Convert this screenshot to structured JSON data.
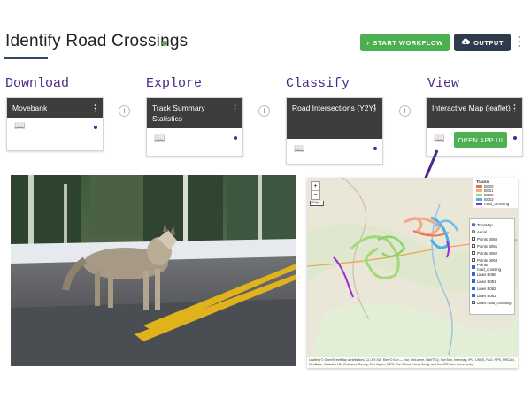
{
  "header": {
    "title": "Identify Road Crossings",
    "start_workflow": "START WORKFLOW",
    "output": "OUTPUT",
    "status_color": "#4caf50"
  },
  "sections": [
    {
      "label": "Download",
      "card_title": "Movebank"
    },
    {
      "label": "Explore",
      "card_title": "Track Summary Statistics"
    },
    {
      "label": "Classify",
      "card_title": "Road Intersections (Y2Y)"
    },
    {
      "label": "View",
      "card_title": "Interactive Map (leaflet)",
      "action": "OPEN APP UI"
    }
  ],
  "map": {
    "legend_title": "Tracks",
    "legend": [
      {
        "label": "B060",
        "color": "#e8734a"
      },
      {
        "label": "B061",
        "color": "#f2a98a"
      },
      {
        "label": "B062",
        "color": "#a3d97a"
      },
      {
        "label": "B063",
        "color": "#4ab0e8"
      },
      {
        "label": "road_crossing",
        "color": "#9c2bd6"
      }
    ],
    "layers": [
      {
        "label": "TopoMap",
        "type": "radio",
        "checked": true
      },
      {
        "label": "Aerial",
        "type": "radio",
        "checked": false
      },
      {
        "label": "Points B060",
        "type": "check",
        "checked": false
      },
      {
        "label": "Points B061",
        "type": "check",
        "checked": false
      },
      {
        "label": "Points B062",
        "type": "check",
        "checked": false
      },
      {
        "label": "Points B063",
        "type": "check",
        "checked": false
      },
      {
        "label": "Points road_crossing",
        "type": "check",
        "checked": true
      },
      {
        "label": "Lines B060",
        "type": "check",
        "checked": true
      },
      {
        "label": "Lines B061",
        "type": "check",
        "checked": true
      },
      {
        "label": "Lines B062",
        "type": "check",
        "checked": true
      },
      {
        "label": "Lines B063",
        "type": "check",
        "checked": true
      },
      {
        "label": "Lines road_crossing",
        "type": "check",
        "checked": false
      }
    ],
    "zoom_in": "+",
    "zoom_out": "−",
    "scale": "10 km",
    "attribution": "Leaflet | © OpenStreetMap contributors, CC-BY-SA, Tiles © Esri — Esri, DeLorme, NAVTEQ, TomTom, Intermap, iPC, USGS, FAO, NPS, NRCAN, GeoBase, Kadaster NL, Ordnance Survey, Esri Japan, METI, Esri China (Hong Kong), and the GIS User Community"
  }
}
